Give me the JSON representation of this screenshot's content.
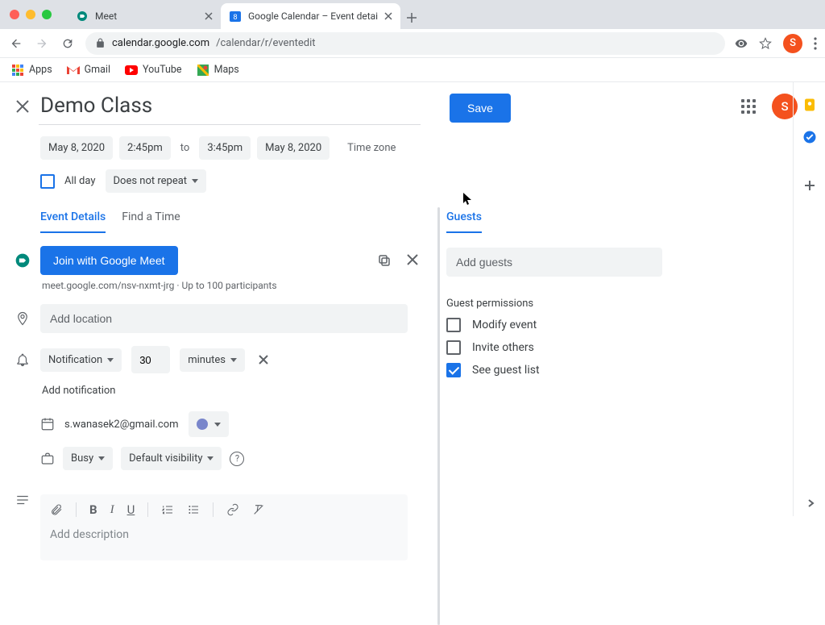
{
  "browser": {
    "tabs": [
      {
        "label": "Meet"
      },
      {
        "label": "Google Calendar – Event detai"
      }
    ],
    "url_host": "calendar.google.com",
    "url_path": "/calendar/r/eventedit",
    "bookmarks": {
      "apps": "Apps",
      "gmail": "Gmail",
      "youtube": "YouTube",
      "maps": "Maps"
    },
    "avatar_initial": "S"
  },
  "event": {
    "title": "Demo Class",
    "save": "Save",
    "start_date": "May 8, 2020",
    "start_time": "2:45pm",
    "to": "to",
    "end_time": "3:45pm",
    "end_date": "May 8, 2020",
    "timezone": "Time zone",
    "all_day": "All day",
    "repeat": "Does not repeat"
  },
  "tabs": {
    "details": "Event Details",
    "find": "Find a Time",
    "guests": "Guests"
  },
  "meet": {
    "join": "Join with Google Meet",
    "link": "meet.google.com/nsv-nxmt-jrg",
    "limit": "Up to 100 participants"
  },
  "location_placeholder": "Add location",
  "notification": {
    "type": "Notification",
    "value": "30",
    "unit": "minutes",
    "add": "Add notification"
  },
  "owner": "s.wanasek2@gmail.com",
  "visibility": {
    "busy": "Busy",
    "default": "Default visibility"
  },
  "description_placeholder": "Add description",
  "guests": {
    "add_placeholder": "Add guests",
    "perm_title": "Guest permissions",
    "modify": "Modify event",
    "invite": "Invite others",
    "see": "See guest list"
  }
}
